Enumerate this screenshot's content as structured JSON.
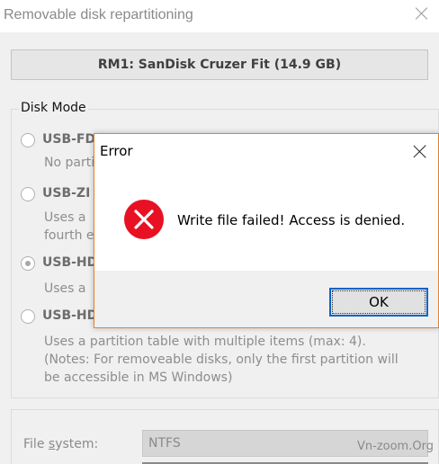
{
  "window": {
    "title": "Removable disk repartitioning"
  },
  "device_button_label": "RM1: SanDisk Cruzer Fit (14.9 GB)",
  "disk_mode": {
    "legend": "Disk Mode",
    "options": [
      {
        "label": "USB-FD",
        "desc": [
          "No parti"
        ],
        "checked": false
      },
      {
        "label": "USB-ZI",
        "desc": [
          "Uses a",
          "fourth e"
        ],
        "checked": false
      },
      {
        "label": "USB-HD",
        "desc": [
          "Uses a"
        ],
        "checked": true
      },
      {
        "label": "USB-HD",
        "desc": [
          "Uses a partition table with multiple items (max: 4).",
          "(Notes: For removeable disks, only the first partition will",
          "be accessible in MS Windows)"
        ],
        "checked": false
      }
    ]
  },
  "filesystem": {
    "label_prefix": "File ",
    "label_underlined": "s",
    "label_suffix": "ystem:",
    "value": "NTFS"
  },
  "watermark": "Vn-zoom.Org",
  "error_dialog": {
    "title": "Error",
    "message": "Write file failed! Access is denied.",
    "ok_label": "OK",
    "icon": "error-icon",
    "accent_color": "#e2832f",
    "icon_color": "#e81123"
  }
}
